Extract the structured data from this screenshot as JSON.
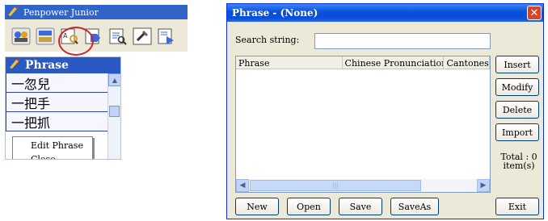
{
  "penpower": {
    "title": "Penpower Junior",
    "tools": [
      {
        "icon": "users-icon"
      },
      {
        "icon": "keyboard-icon"
      },
      {
        "icon": "phrase-icon",
        "highlighted": true
      },
      {
        "icon": "export-icon"
      },
      {
        "icon": "search-doc-icon"
      },
      {
        "icon": "setup-icon"
      },
      {
        "icon": "play-doc-icon"
      }
    ]
  },
  "phrase_panel": {
    "title": "Phrase",
    "rows": [
      "一忽兒",
      "一把手",
      "一把抓"
    ],
    "context_menu": [
      "Edit Phrase",
      "Close"
    ]
  },
  "dialog": {
    "title": "Phrase - (None)",
    "search_label": "Search string:",
    "search_value": "",
    "columns": [
      "Phrase",
      "Chinese Pronunciation",
      "Cantonese Pronunciation"
    ],
    "side_buttons": [
      "Insert",
      "Modify",
      "Delete",
      "Import"
    ],
    "total_label": "Total :",
    "total_count": "0",
    "total_unit": "item(s)",
    "bottom_buttons": [
      "New",
      "Open",
      "Save",
      "SaveAs"
    ],
    "exit_label": "Exit"
  },
  "colors": {
    "title_blue": "#0a58e0",
    "highlight_ring": "#d2232a",
    "close_red": "#d7442e"
  }
}
